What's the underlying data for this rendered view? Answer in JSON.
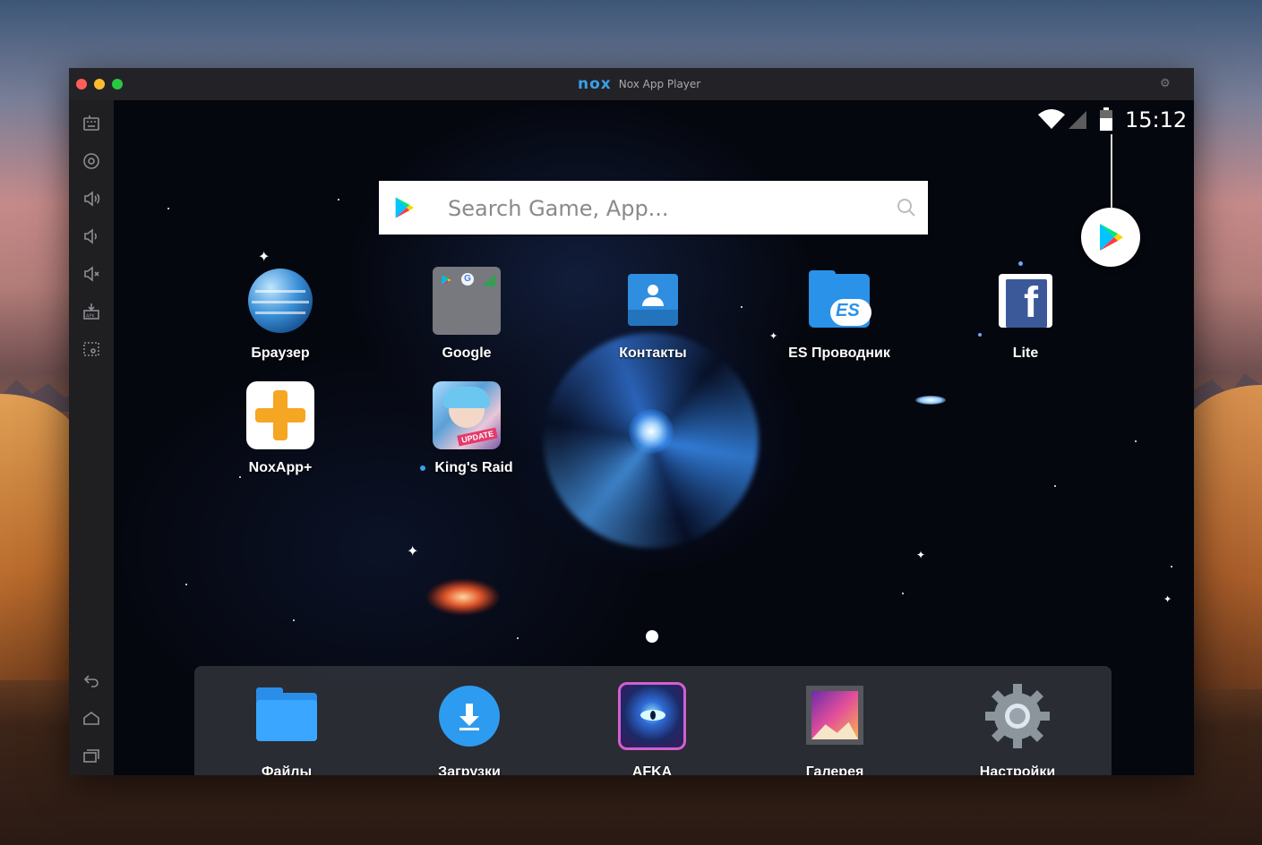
{
  "window": {
    "title": "Nox App Player",
    "logo_text": "nox"
  },
  "status": {
    "time": "15:12"
  },
  "search": {
    "placeholder": "Search Game, App..."
  },
  "home_apps": [
    {
      "label": "Браузер",
      "icon": "globe-icon"
    },
    {
      "label": "Google",
      "icon": "google-folder-icon"
    },
    {
      "label": "Контакты",
      "icon": "contacts-icon"
    },
    {
      "label": "ES Проводник",
      "icon": "es-explorer-icon"
    },
    {
      "label": "Lite",
      "icon": "facebook-lite-icon"
    },
    {
      "label": "NoxApp+",
      "icon": "noxapp-plus-icon"
    },
    {
      "label": "King's Raid",
      "icon": "kings-raid-icon",
      "new_indicator": true
    }
  ],
  "dock_apps": [
    {
      "label": "Файлы",
      "icon": "folder-icon"
    },
    {
      "label": "Загрузки",
      "icon": "download-icon"
    },
    {
      "label": "AFKA",
      "icon": "afka-game-icon"
    },
    {
      "label": "Галерея",
      "icon": "gallery-icon"
    },
    {
      "label": "Настройки",
      "icon": "settings-gear-icon"
    }
  ],
  "sidebar": {
    "top": [
      "keyboard-icon",
      "location-icon",
      "volume-up-icon",
      "volume-down-icon",
      "mute-icon",
      "apk-install-icon",
      "screen-record-icon"
    ],
    "bottom": [
      "back-icon",
      "home-icon",
      "recent-apps-icon"
    ]
  },
  "colors": {
    "accent": "#3aa0e8",
    "titlebar": "#232327",
    "sidebar": "#1f1f22"
  },
  "pager": {
    "current_page": 1
  }
}
